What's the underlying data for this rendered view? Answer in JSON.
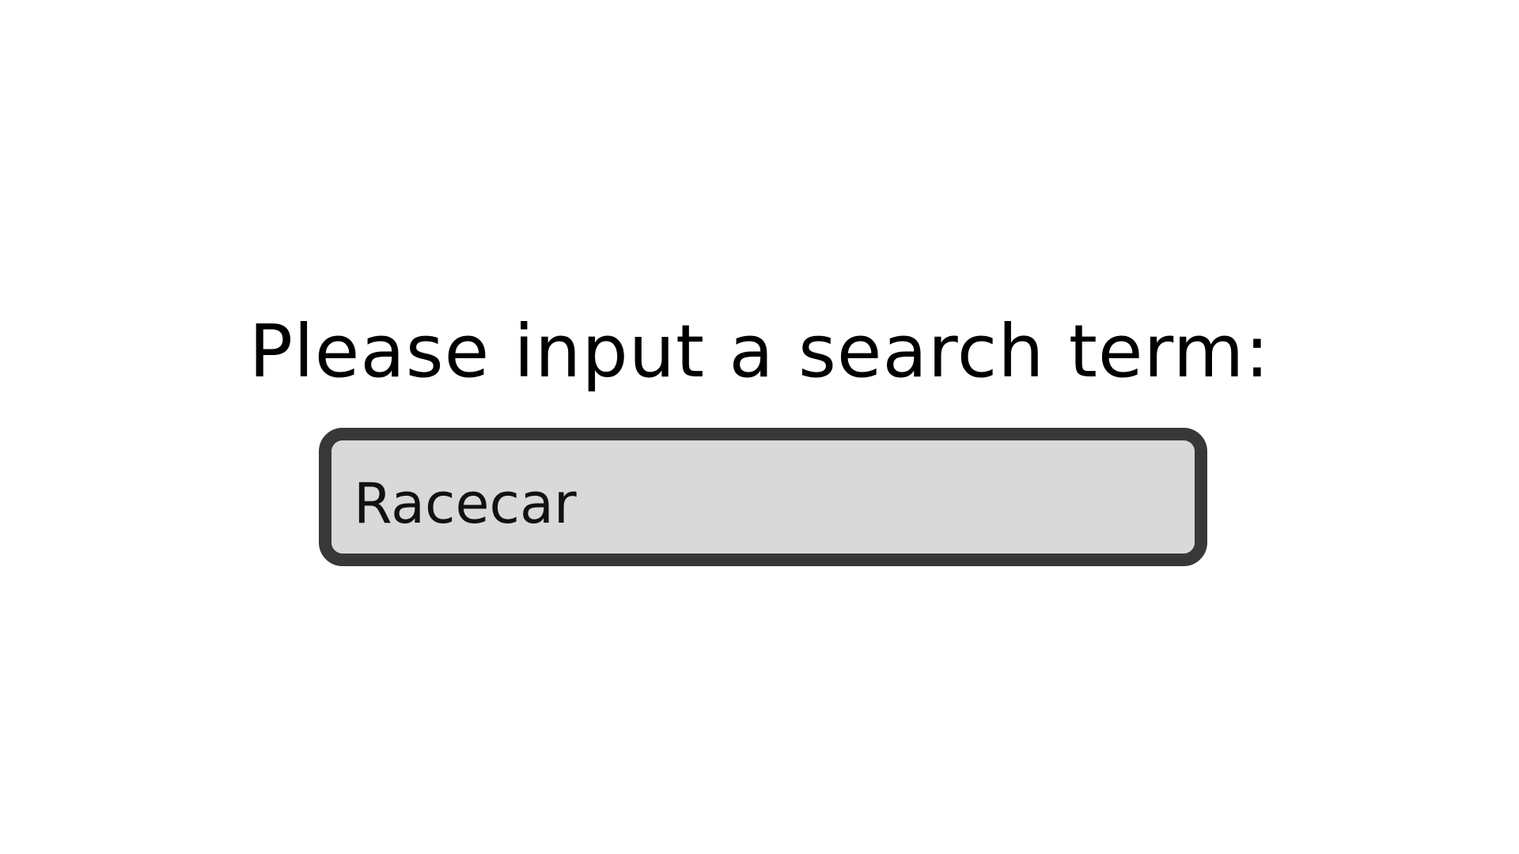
{
  "prompt": {
    "text": "Please input a search term:"
  },
  "search": {
    "value": "Racecar"
  },
  "colors": {
    "background": "#ffffff",
    "input_fill": "#d9d9d9",
    "input_border": "#383838",
    "text": "#000000"
  }
}
